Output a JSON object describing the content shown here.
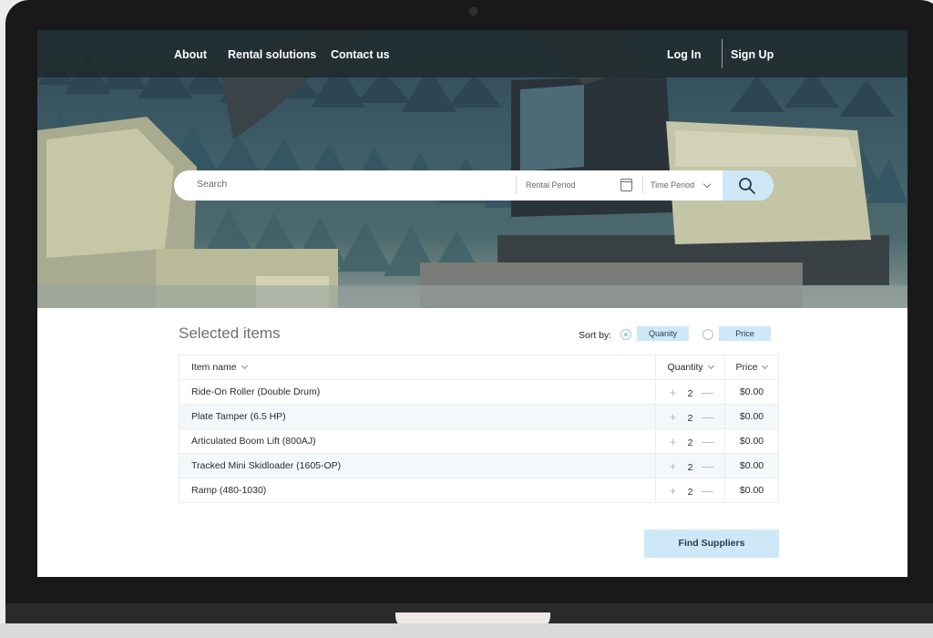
{
  "nav": {
    "about": "About",
    "rental_solutions": "Rental solutions",
    "contact": "Contact us",
    "login": "Log In",
    "signup": "Sign Up"
  },
  "search": {
    "placeholder": "Search",
    "rental_period": "Rental Period",
    "time_period": "Time Period"
  },
  "selected": {
    "title": "Selected items",
    "sort_label": "Sort by:",
    "sort_options": [
      "Quanity",
      "Price"
    ],
    "selected_sort": "Quanity"
  },
  "table": {
    "headers": {
      "name": "Item name",
      "quantity": "Quantity",
      "price": "Price"
    },
    "rows": [
      {
        "name": "Ride-On Roller (Double Drum)",
        "qty": "2",
        "price": "$0.00"
      },
      {
        "name": "Plate Tamper (6.5 HP)",
        "qty": "2",
        "price": "$0.00"
      },
      {
        "name": "Articulated Boom Lift (800AJ)",
        "qty": "2",
        "price": "$0.00"
      },
      {
        "name": "Tracked Mini Skidloader (1605-OP)",
        "qty": "2",
        "price": "$0.00"
      },
      {
        "name": "Ramp (480-1030)",
        "qty": "2",
        "price": "$0.00"
      }
    ],
    "plus": "+",
    "minus": "—"
  },
  "actions": {
    "find_suppliers": "Find Suppliers"
  },
  "colors": {
    "accent": "#cfe8f7",
    "nav_bg": "#1c2426",
    "row_alt": "#f3f8fb"
  },
  "icons": [
    "search-icon",
    "calendar-icon",
    "chevron-down-icon",
    "plus-icon",
    "minus-icon"
  ]
}
